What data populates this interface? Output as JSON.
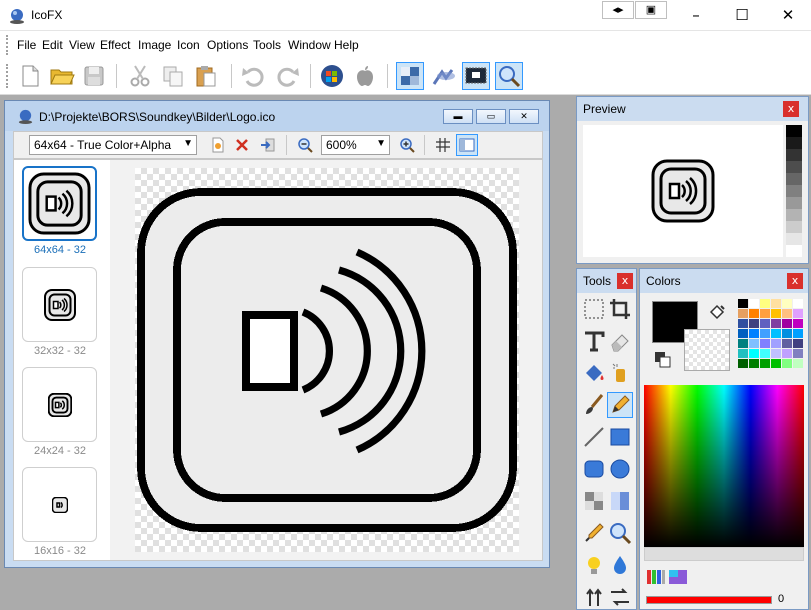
{
  "app": {
    "title": "IcoFX"
  },
  "titlebar_buttons": {
    "arrows": "◂▸",
    "window_icon": "▣"
  },
  "menu": [
    "File",
    "Edit",
    "View",
    "Effect",
    "Image",
    "Icon",
    "Options",
    "Tools",
    "Window",
    "Help"
  ],
  "toolbar": {
    "items": [
      "new-file-icon",
      "open-folder-icon",
      "save-icon",
      "cut-icon",
      "copy-icon",
      "paste-icon",
      "undo-icon",
      "redo-icon",
      "windows-logo-icon",
      "apple-logo-icon",
      "image-editor-icon",
      "extract-icon",
      "screen-capture-icon",
      "zoom-icon"
    ]
  },
  "document": {
    "path": "D:\\Projekte\\BORS\\Soundkey\\Bilder\\Logo.ico",
    "format_value": "64x64 - True Color+Alpha",
    "zoom_value": "600%"
  },
  "thumbnails": [
    {
      "label": "64x64 - 32",
      "selected": true
    },
    {
      "label": "32x32 - 32",
      "selected": false
    },
    {
      "label": "24x24 - 32",
      "selected": false
    },
    {
      "label": "16x16 - 32",
      "selected": false
    }
  ],
  "panels": {
    "preview": {
      "title": "Preview"
    },
    "tools": {
      "title": "Tools"
    },
    "colors": {
      "title": "Colors",
      "opacity_value": "0",
      "primary": "#000000"
    }
  },
  "close_glyph": "x",
  "grays": [
    "#000000",
    "#1a1a1a",
    "#333333",
    "#4d4d4d",
    "#666666",
    "#808080",
    "#999999",
    "#b3b3b3",
    "#cccccc",
    "#e6e6e6",
    "#ffffff"
  ],
  "palette": [
    "#000000",
    "#ffffff",
    "#ffff80",
    "#ffe0a0",
    "#ffffc0",
    "#ffffff",
    "#e6a060",
    "#ff8000",
    "#ffa040",
    "#ffc000",
    "#ffc080",
    "#e0a0ff",
    "#3050a0",
    "#404080",
    "#6060c0",
    "#8040a0",
    "#a000a0",
    "#c000c0",
    "#0060c0",
    "#0080ff",
    "#40a0ff",
    "#00c0ff",
    "#0090e0",
    "#00a0ff",
    "#008080",
    "#80c0ff",
    "#8080ff",
    "#a0a0ff",
    "#6060a0",
    "#404080",
    "#20c0c0",
    "#00ffff",
    "#40ffff",
    "#c0c0ff",
    "#c0a0ff",
    "#8080c0",
    "#006000",
    "#008000",
    "#00a000",
    "#00c000",
    "#80ff80",
    "#c0ffc0"
  ]
}
